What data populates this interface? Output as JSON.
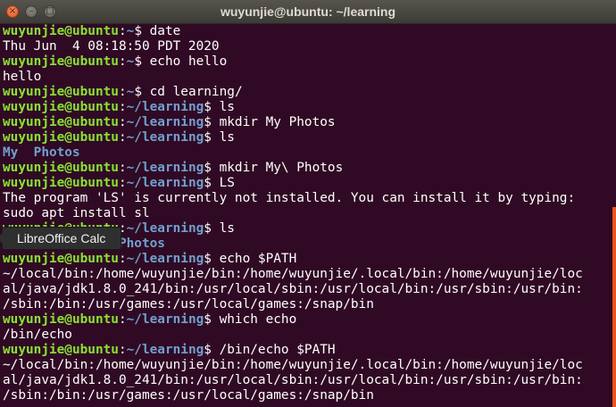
{
  "window": {
    "title": "wuyunjie@ubuntu: ~/learning",
    "close_glyph": "×",
    "minimize_glyph": "–",
    "maximize_glyph": "□"
  },
  "tooltip": {
    "text": "LibreOffice Calc"
  },
  "colors": {
    "background": "#300a24",
    "prompt_user": "#8ae234",
    "prompt_path": "#729fcf",
    "directory": "#729fcf",
    "scrollbar": "#e95420"
  },
  "prompt": {
    "user_host": "wuyunjie@ubuntu",
    "sep": ":",
    "home": "~",
    "learning": "~/learning",
    "dollar": "$ "
  },
  "terminal": {
    "lines": [
      {
        "type": "prompt",
        "path": "~",
        "cmd": "date"
      },
      {
        "type": "out",
        "text": "Thu Jun  4 08:18:50 PDT 2020"
      },
      {
        "type": "prompt",
        "path": "~",
        "cmd": "echo hello"
      },
      {
        "type": "out",
        "text": "hello"
      },
      {
        "type": "prompt",
        "path": "~",
        "cmd": "cd learning/"
      },
      {
        "type": "prompt",
        "path": "~/learning",
        "cmd": "ls"
      },
      {
        "type": "prompt",
        "path": "~/learning",
        "cmd": "mkdir My Photos"
      },
      {
        "type": "prompt",
        "path": "~/learning",
        "cmd": "ls"
      },
      {
        "type": "dir",
        "text": "My  Photos"
      },
      {
        "type": "prompt",
        "path": "~/learning",
        "cmd": "mkdir My\\ Photos"
      },
      {
        "type": "prompt",
        "path": "~/learning",
        "cmd": "LS"
      },
      {
        "type": "out",
        "text": "The program 'LS' is currently not installed. You can install it by typing:"
      },
      {
        "type": "out",
        "text": "sudo apt install sl"
      },
      {
        "type": "prompt",
        "path": "~/learning",
        "cmd": "ls"
      },
      {
        "type": "dir",
        "text": "My  My Photos  Photos"
      },
      {
        "type": "prompt",
        "path": "~/learning",
        "cmd": "echo $PATH"
      },
      {
        "type": "out",
        "text": "~/local/bin:/home/wuyunjie/bin:/home/wuyunjie/.local/bin:/home/wuyunjie/loc"
      },
      {
        "type": "out",
        "text": "al/java/jdk1.8.0_241/bin:/usr/local/sbin:/usr/local/bin:/usr/sbin:/usr/bin:"
      },
      {
        "type": "out",
        "text": "/sbin:/bin:/usr/games:/usr/local/games:/snap/bin"
      },
      {
        "type": "prompt",
        "path": "~/learning",
        "cmd": "which echo"
      },
      {
        "type": "out",
        "text": "/bin/echo"
      },
      {
        "type": "prompt",
        "path": "~/learning",
        "cmd": "/bin/echo $PATH"
      },
      {
        "type": "out",
        "text": "~/local/bin:/home/wuyunjie/bin:/home/wuyunjie/.local/bin:/home/wuyunjie/loc"
      },
      {
        "type": "out",
        "text": "al/java/jdk1.8.0_241/bin:/usr/local/sbin:/usr/local/bin:/usr/sbin:/usr/bin:"
      },
      {
        "type": "out",
        "text": "/sbin:/bin:/usr/games:/usr/local/games:/snap/bin"
      }
    ]
  }
}
